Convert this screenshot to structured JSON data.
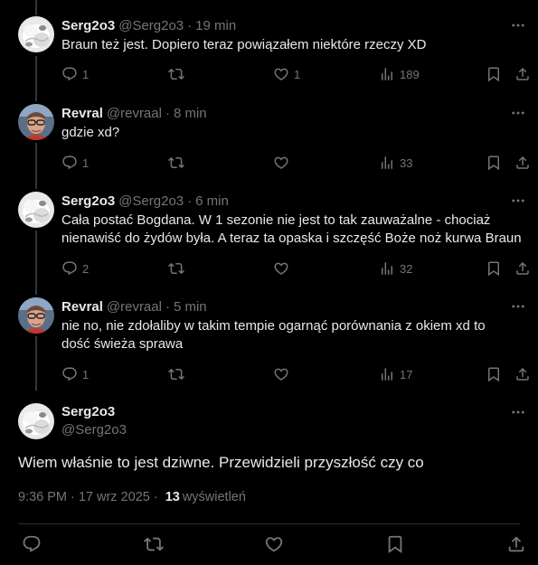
{
  "replies": [
    {
      "name": "Serg2o3",
      "handle": "@Serg2o3",
      "time": "19 min",
      "text": "Braun też jest. Dopiero teraz powiązałem niektóre rzeczy XD",
      "avatar": "fluffy-white-figure",
      "replies": "1",
      "reposts": "",
      "likes": "1",
      "views": "189"
    },
    {
      "name": "Revral",
      "handle": "@revraal",
      "time": "8 min",
      "text": "gdzie xd?",
      "avatar": "person-with-glasses",
      "replies": "1",
      "reposts": "",
      "likes": "",
      "views": "33"
    },
    {
      "name": "Serg2o3",
      "handle": "@Serg2o3",
      "time": "6 min",
      "text": "Cała postać Bogdana. W 1 sezonie nie jest to tak zauważalne - chociaż\nnienawiść do żydów była. A teraz ta opaska i szczęść Boże noż kurwa Braun",
      "avatar": "fluffy-white-figure",
      "replies": "2",
      "reposts": "",
      "likes": "",
      "views": "32"
    },
    {
      "name": "Revral",
      "handle": "@revraal",
      "time": "5 min",
      "text": "nie no, nie zdołaliby w takim tempie ogarnąć porównania z okiem xd to\ndość świeża sprawa",
      "avatar": "person-with-glasses",
      "replies": "1",
      "reposts": "",
      "likes": "",
      "views": "17"
    }
  ],
  "main": {
    "name": "Serg2o3",
    "handle": "@Serg2o3",
    "text": "Wiem właśnie to jest dziwne. Przewidzieli przyszłość czy co",
    "time": "9:36 PM",
    "date": "17 wrz 2025",
    "views_count": "13",
    "views_label": "wyświetleń",
    "separator": "·"
  },
  "icons": {
    "reply": "reply-icon",
    "repost": "repost-icon",
    "like": "heart-icon",
    "views": "views-icon",
    "bookmark": "bookmark-icon",
    "share": "share-icon",
    "more": "more-icon"
  },
  "colors": {
    "background": "#000000",
    "text": "#e7e9ea",
    "muted": "#71767b",
    "divider": "#2f3336"
  }
}
